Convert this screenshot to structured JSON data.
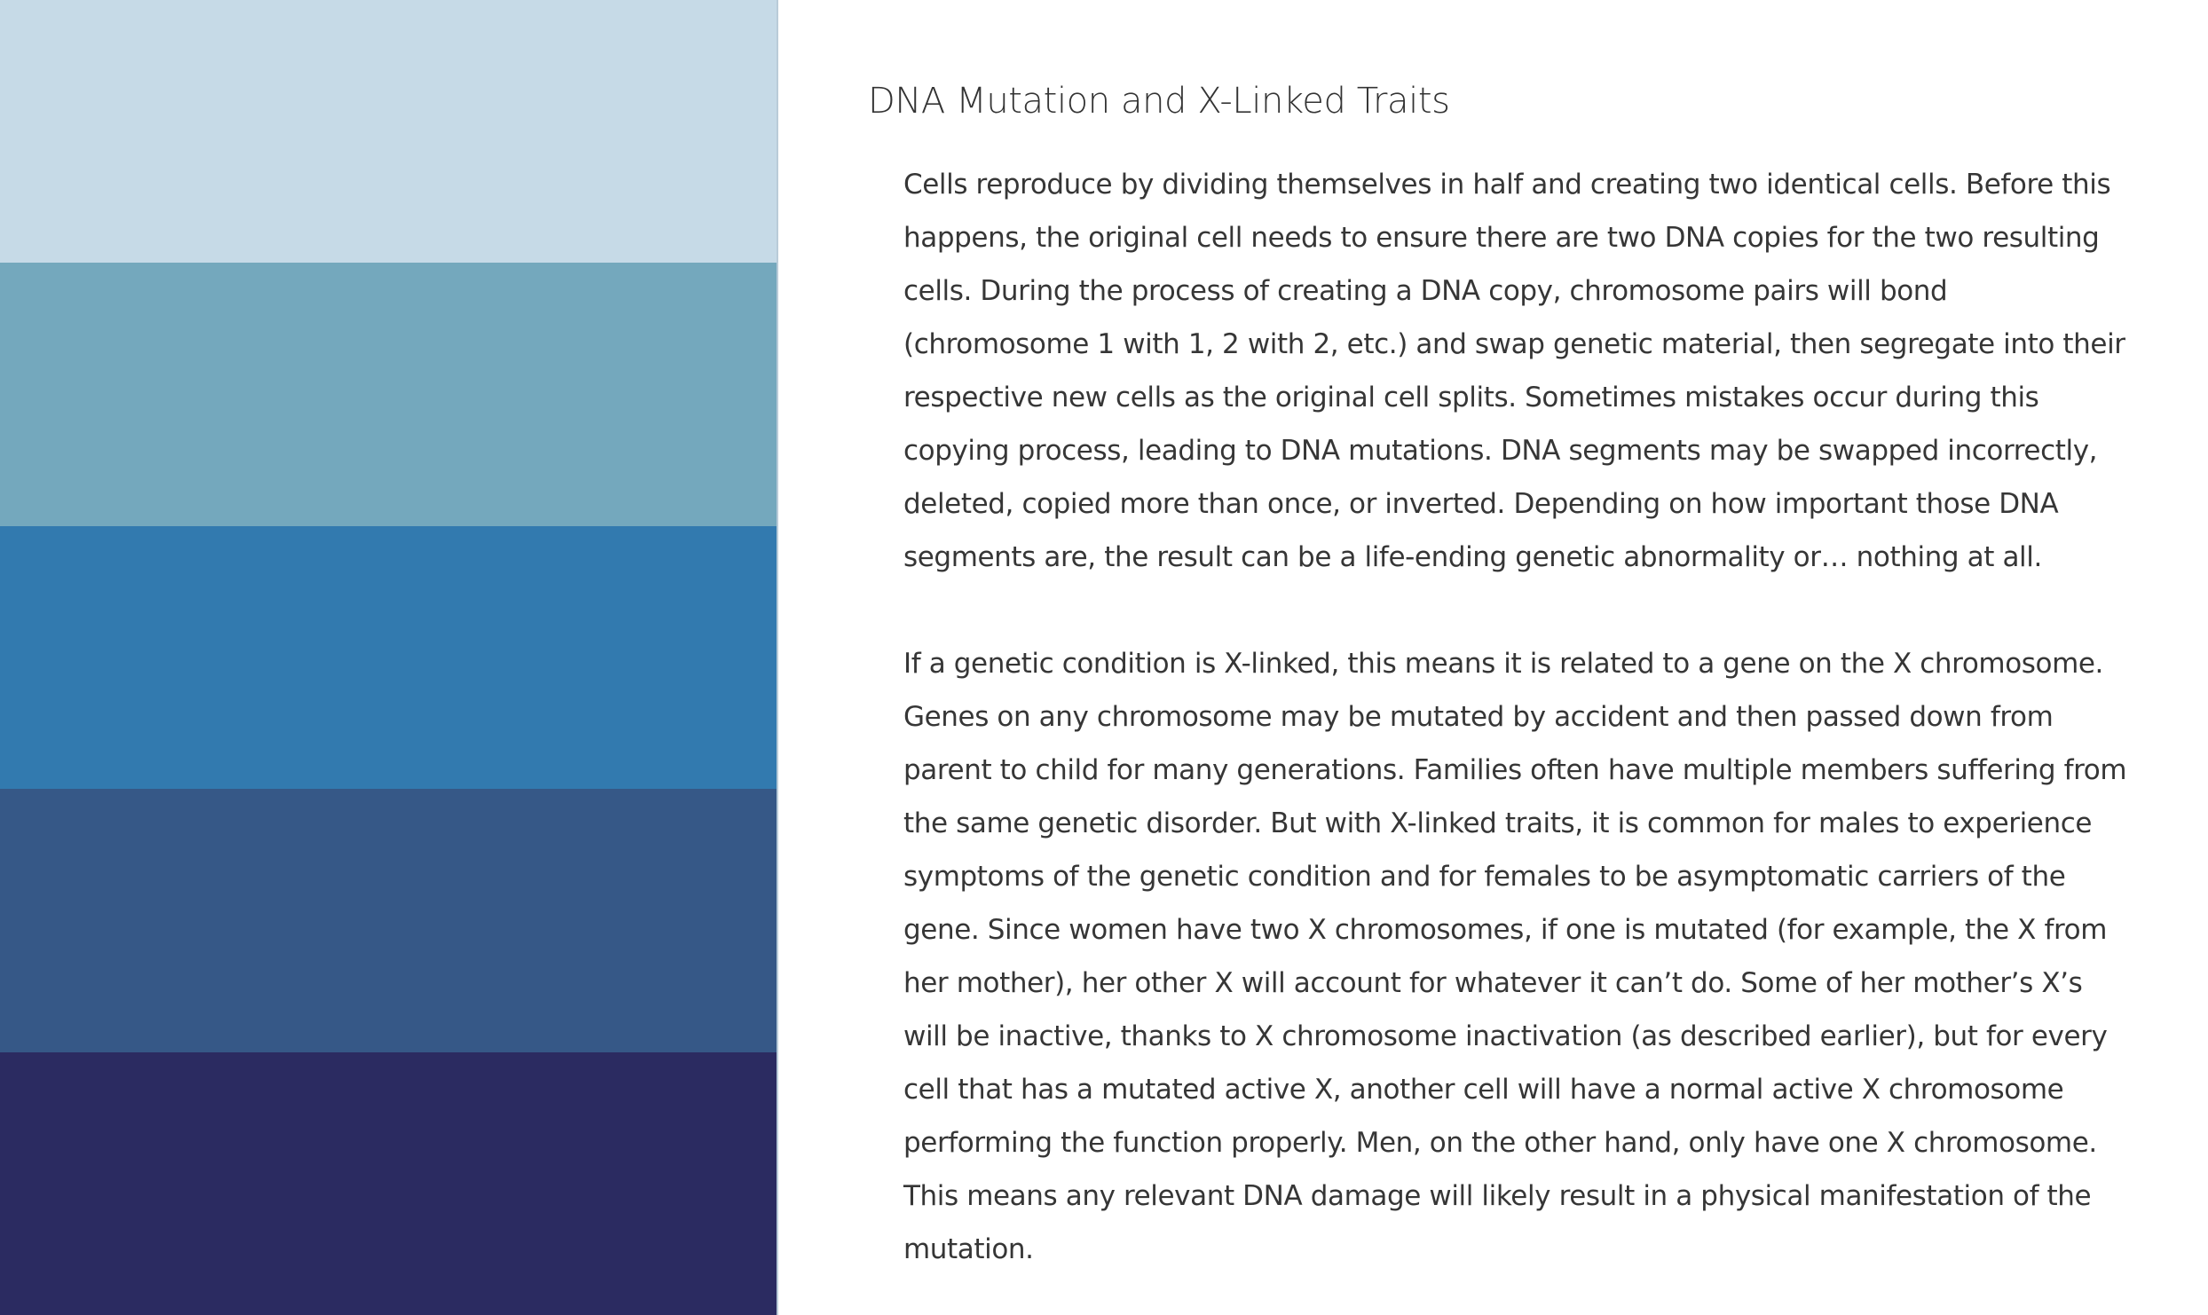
{
  "palette": {
    "swatches": [
      {
        "name": "pale-blue",
        "color": "#c6dae7"
      },
      {
        "name": "teal-blue",
        "color": "#74a8bd"
      },
      {
        "name": "medium-blue",
        "color": "#327aaf"
      },
      {
        "name": "slate-blue",
        "color": "#365887"
      },
      {
        "name": "navy",
        "color": "#2b2b61"
      }
    ]
  },
  "document": {
    "title": "DNA Mutation and X-Linked Traits",
    "paragraphs": [
      "Cells reproduce by dividing themselves in half and creating two identical cells. Before this happens, the original cell needs to ensure there are two DNA copies for the two resulting cells. During the process of creating a DNA copy, chromosome pairs will bond (chromosome 1 with 1, 2 with 2, etc.) and swap genetic material, then segregate into their respective new cells as the original cell splits. Sometimes mistakes occur during this copying process, leading to DNA mutations. DNA segments may be swapped incorrectly, deleted, copied more than once, or inverted. Depending on how important those DNA segments are, the result can be a life-ending genetic abnormality or… nothing at all.",
      "If a genetic condition is X-linked, this means it is related to a gene on the X chromosome. Genes on any chromosome may be mutated by accident and then passed down from parent to child for many generations. Families often have multiple members suffering from the same genetic disorder. But with X-linked traits, it is common for males to experience symptoms of the genetic condition and for females to be asymptomatic carriers of the gene. Since women have two X chromosomes, if one is mutated (for example, the X from her mother), her other X will account for whatever it can’t do. Some of her mother’s X’s will be inactive, thanks to X chromosome inactivation (as described earlier), but for every cell that has a mutated active X, another cell will have a normal active X chromosome performing the function properly. Men, on the other hand, only have one X chromosome. This means any relevant DNA damage will likely result in a physical manifestation of the mutation."
    ]
  }
}
